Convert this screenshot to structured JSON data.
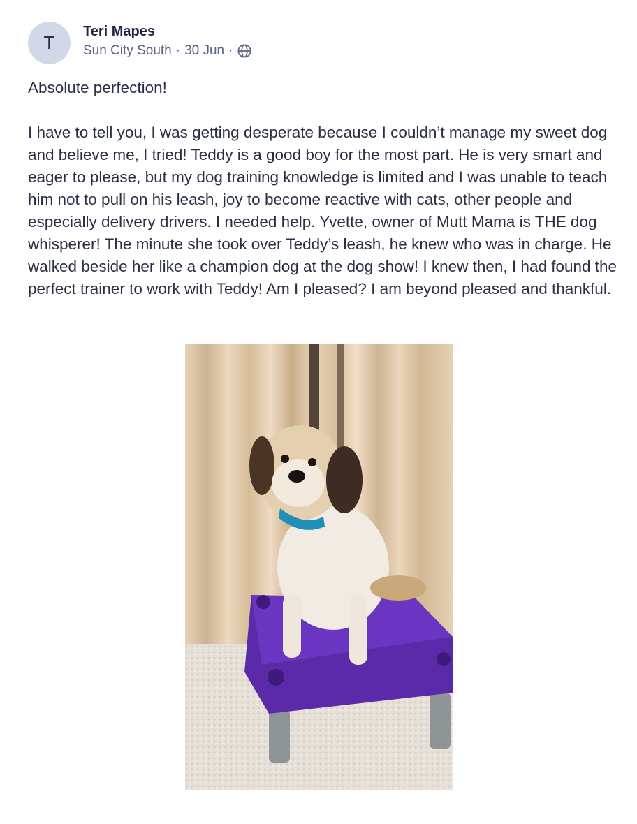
{
  "post": {
    "author": {
      "initial": "T",
      "name": "Teri Mapes"
    },
    "location": "Sun City South",
    "separator": "·",
    "date": "30 Jun",
    "visibility_icon": "globe-icon",
    "title": "Absolute perfection!",
    "body": "I have to tell you, I was getting desperate because I couldn’t manage my sweet dog and believe me, I tried! Teddy is a good boy for the most part. He is very smart and eager to please, but my dog training knowledge is limited and I was unable to teach him not to pull on his leash, joy to become reactive with cats, other people and especially delivery drivers. I needed help. Yvette, owner of Mutt Mama is THE dog whisperer! The minute she took over Teddy’s leash, he knew who was in charge. He walked beside her like a champion dog at the dog show! I knew then, I had found the perfect trainer to work with Teddy! Am I pleased? I am beyond pleased and thankful."
  },
  "colors": {
    "avatar_bg": "#d3d8e8",
    "text": "#2a2f45",
    "meta_text": "#5b6284",
    "platform_purple": "#5a2aa8",
    "collar_blue": "#1f8fb8"
  }
}
